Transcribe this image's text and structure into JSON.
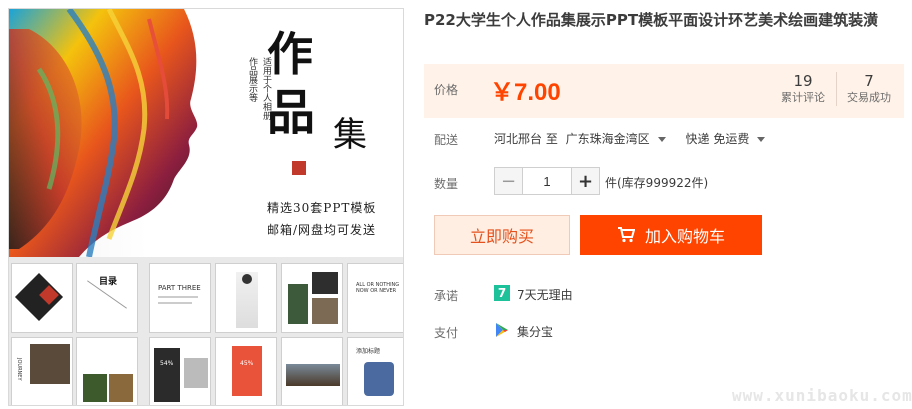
{
  "product": {
    "title": "P22大学生个人作品集展示PPT模板平面设计环艺美术绘画建筑装潢",
    "image": {
      "zuo": "作",
      "pin": "品",
      "ji": "集",
      "vertical_1": "适用于个人相册",
      "vertical_2": "作品展示等",
      "line_1": "精选30套PPT模板",
      "line_2": "邮箱/网盘均可发送",
      "thumb_toc": "目录",
      "thumb_part": "PART THREE",
      "thumb_all": "ALL OR NOTHING NOW OR NEVER",
      "thumb_journey": "JOURNEY",
      "thumb_54": "54%",
      "thumb_45": "45%",
      "thumb_add": "添加标题"
    }
  },
  "price": {
    "label": "价格",
    "value": "￥7.00",
    "reviews_count": "19",
    "reviews_label": "累计评论",
    "deals_count": "7",
    "deals_label": "交易成功"
  },
  "shipping": {
    "label": "配送",
    "from": "河北邢台 至",
    "to": "广东珠海金湾区",
    "method": "快递 免运费"
  },
  "quantity": {
    "label": "数量",
    "minus": "−",
    "plus": "+",
    "value": "1",
    "stock": "件(库存999922件)"
  },
  "actions": {
    "buy_now": "立即购买",
    "add_cart": "加入购物车"
  },
  "promise": {
    "label": "承诺",
    "icon_text": "7",
    "text": "7天无理由"
  },
  "payment": {
    "label": "支付",
    "text": "集分宝"
  },
  "watermark": "www.xunibaoku.com",
  "colors": {
    "accent": "#ff4400",
    "price_bg": "#fff2e8",
    "buy_now_bg": "#ffeee1",
    "promise_green": "#1dc19a"
  }
}
